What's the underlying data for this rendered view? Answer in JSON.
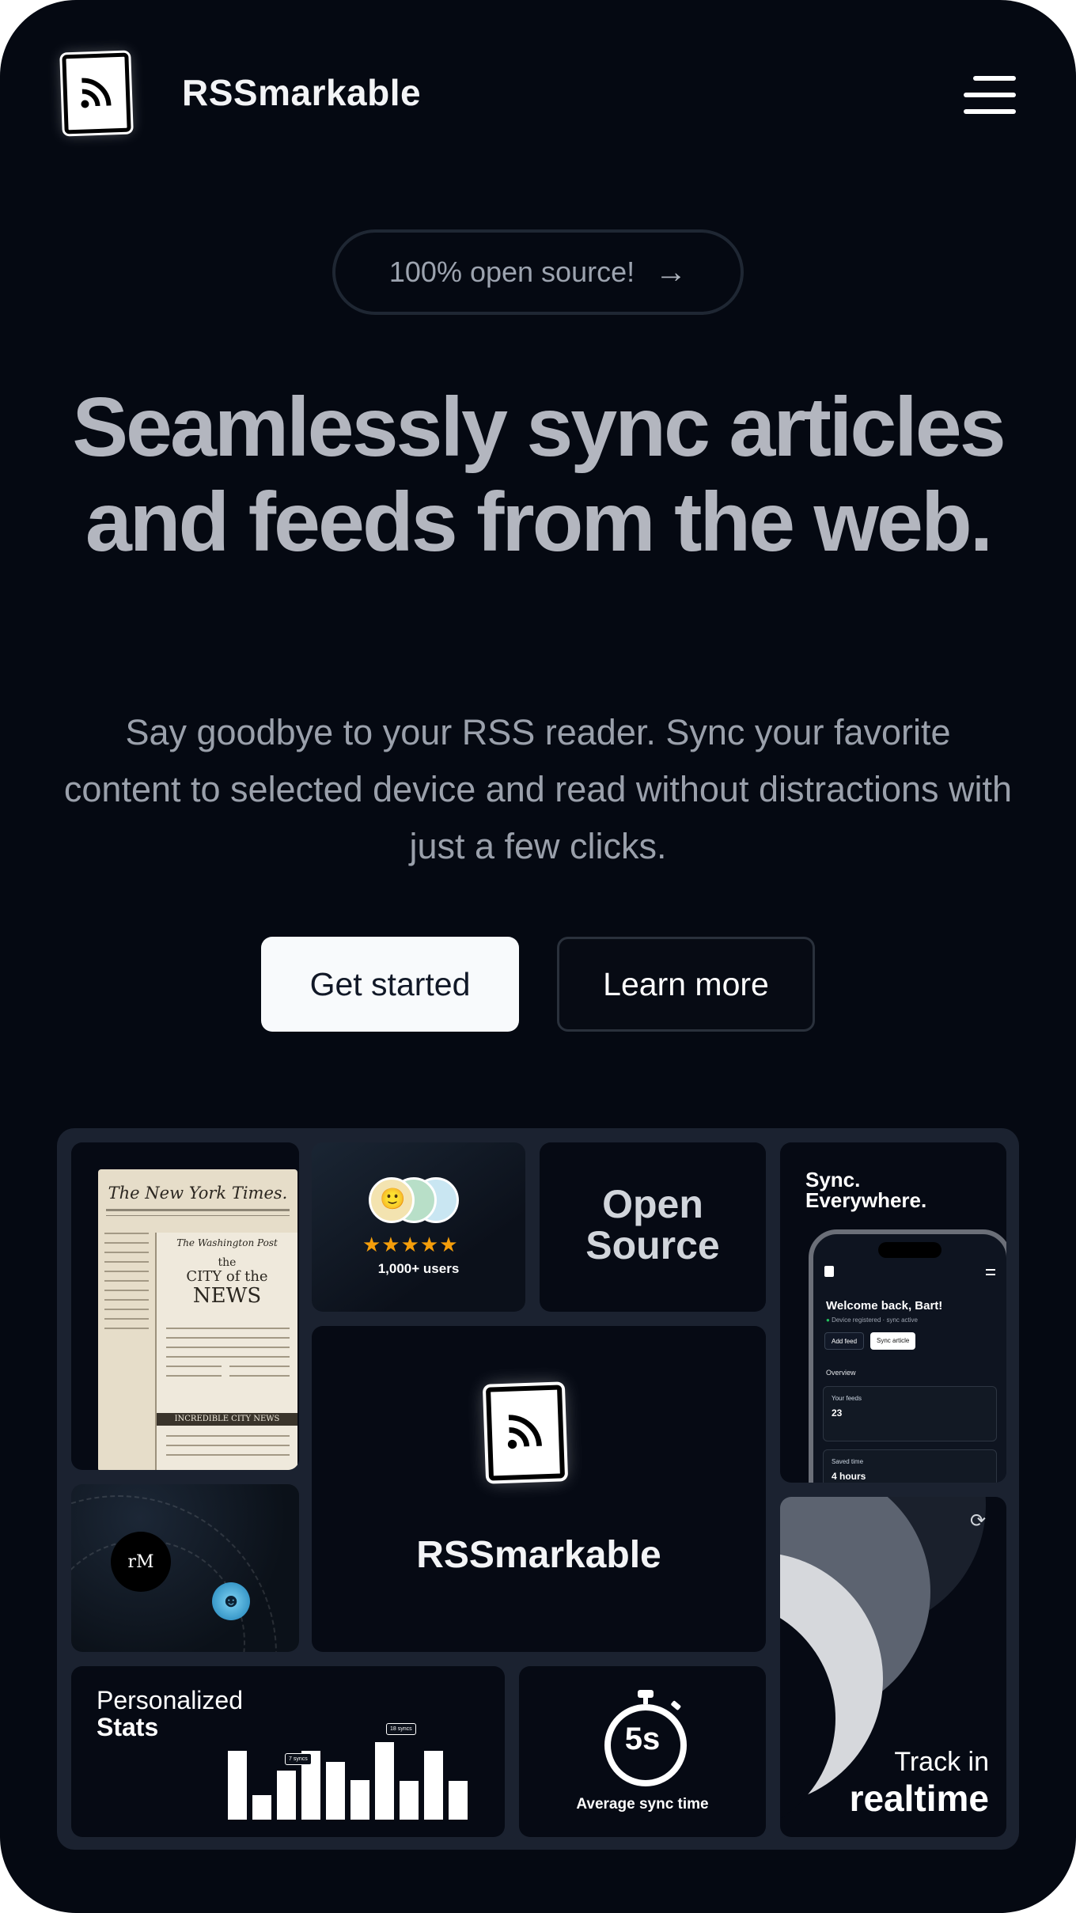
{
  "header": {
    "brand": "RSSmarkable",
    "logo_icon": "rss-icon",
    "menu_icon": "hamburger-menu-icon"
  },
  "announcement": {
    "label": "100% open source!",
    "icon": "arrow-right-icon"
  },
  "hero": {
    "headline": "Seamlessly sync articles and feeds from the web.",
    "subheadline": "Say goodbye to your RSS reader. Sync your favorite content to selected device and read without distractions with just a few clicks.",
    "primary_button": "Get started",
    "secondary_button": "Learn more"
  },
  "bento": {
    "newspaper": {
      "masthead": "The New York Times.",
      "masthead2": "The Washington Post",
      "city_line1": "the",
      "city_line2": "CITY of the",
      "city_line3": "NEWS",
      "banner": "INCREDIBLE CITY NEWS"
    },
    "users": {
      "rating_stars": 5,
      "label": "1,000+ users"
    },
    "open_source": {
      "line1": "Open",
      "line2": "Source"
    },
    "sync": {
      "title_line1": "Sync.",
      "title_line2": "Everywhere.",
      "phone": {
        "welcome": "Welcome back, Bart!",
        "status": "Device registered · sync active",
        "add_feed": "Add feed",
        "sync_article": "Sync article",
        "overview": "Overview",
        "cards": [
          {
            "label": "Your feeds",
            "value": "23"
          },
          {
            "label": "Saved time",
            "value": "4 hours"
          }
        ]
      }
    },
    "center": {
      "brand": "RSSmarkable"
    },
    "devices": {
      "remarkable_label": "rM"
    },
    "realtime": {
      "line1": "Track in",
      "line2": "realtime"
    },
    "stats": {
      "title_line1": "Personalized",
      "title_line2": "Stats",
      "bar_values": [
        0.62,
        0.22,
        0.44,
        0.62,
        0.52,
        0.36,
        0.7,
        0.35,
        0.62,
        0.35
      ],
      "tip1": "7 syncs",
      "tip2": "18 syncs"
    },
    "sync_time": {
      "value": "5s",
      "label": "Average sync time"
    }
  }
}
